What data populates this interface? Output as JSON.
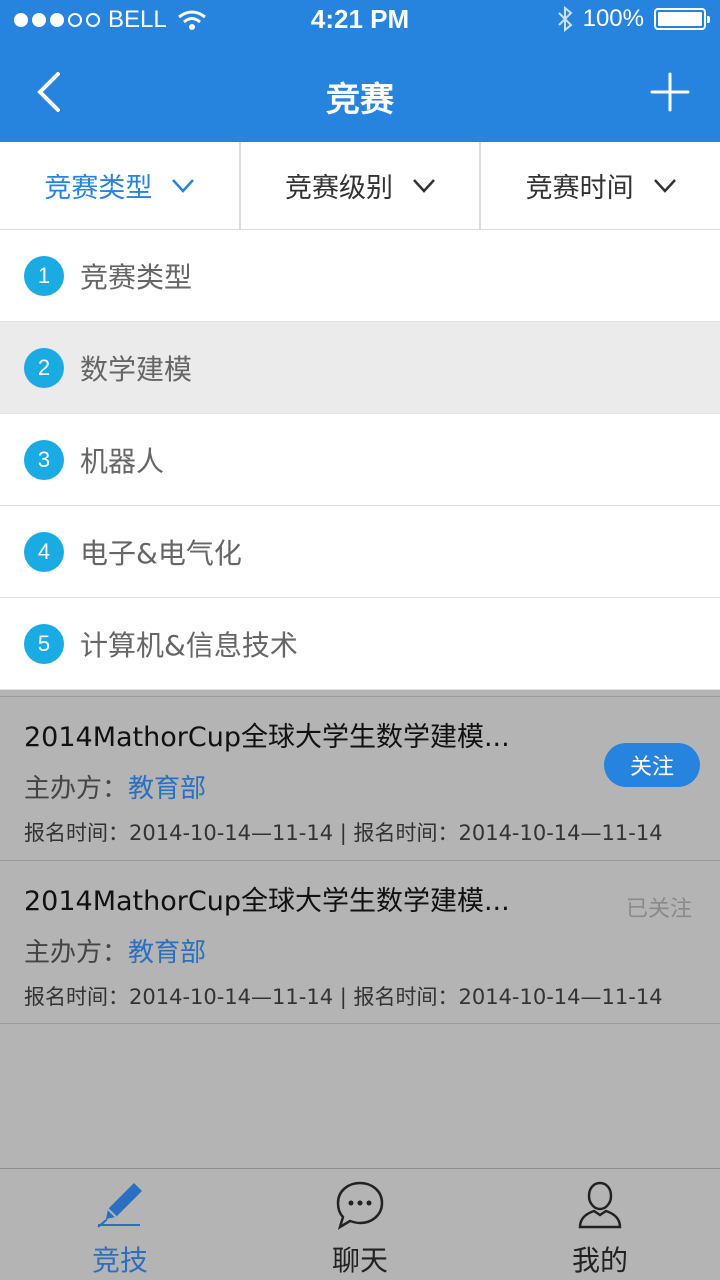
{
  "status": {
    "carrier": "BELL",
    "time": "4:21 PM",
    "battery": "100%"
  },
  "nav": {
    "title": "竞赛"
  },
  "filters": [
    {
      "label": "竞赛类型",
      "active": true
    },
    {
      "label": "竞赛级别",
      "active": false
    },
    {
      "label": "竞赛时间",
      "active": false
    }
  ],
  "dropdown": [
    {
      "num": "1",
      "label": "竞赛类型"
    },
    {
      "num": "2",
      "label": "数学建模",
      "selected": true
    },
    {
      "num": "3",
      "label": "机器人"
    },
    {
      "num": "4",
      "label": "电子&电气化"
    },
    {
      "num": "5",
      "label": "计算机&信息技术"
    }
  ],
  "cards": [
    {
      "title": "2014MathorCup全球大学生数学建模...",
      "org_label": "主办方：",
      "org_value": "教育部",
      "time": "报名时间：2014-10-14—11-14 | 报名时间：2014-10-14—11-14",
      "follow": "关注"
    },
    {
      "title": "2014MathorCup全球大学生数学建模...",
      "org_label": "主办方：",
      "org_value": "教育部",
      "time": "报名时间：2014-10-14—11-14 | 报名时间：2014-10-14—11-14",
      "followed": "已关注"
    }
  ],
  "tabs": [
    {
      "label": "竞技",
      "icon": "pen-icon",
      "active": true
    },
    {
      "label": "聊天",
      "icon": "chat-icon"
    },
    {
      "label": "我的",
      "icon": "user-icon"
    }
  ],
  "colors": {
    "primary": "#2683de",
    "badge": "#1aabe2",
    "overlay": "#b4b4b4"
  }
}
